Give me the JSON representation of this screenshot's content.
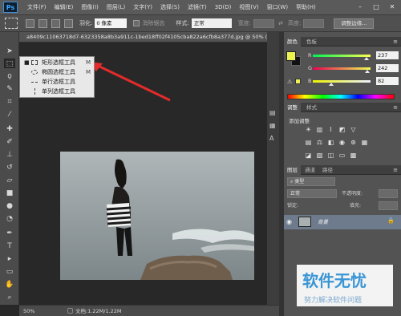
{
  "app": {
    "logo": "Ps",
    "menus": [
      "文件(F)",
      "编辑(E)",
      "图像(I)",
      "图层(L)",
      "文字(Y)",
      "选择(S)",
      "滤镜(T)",
      "3D(D)",
      "视图(V)",
      "窗口(W)",
      "帮助(H)"
    ],
    "window_buttons": [
      "–",
      "□",
      "✕"
    ]
  },
  "options_bar": {
    "feather_label": "羽化:",
    "feather_value": "0 像素",
    "antialias_label": "消除锯齿",
    "style_label": "样式:",
    "style_value": "正常",
    "width_label": "宽度:",
    "height_label": "高度:",
    "refine_button": "调整边缘..."
  },
  "document": {
    "tab_title": "a8409c11063718d7-6323358a8b3a911c-1bed18ff02f4105cba822a6cfb8a377d.jpg @ 50% (RGB/8)"
  },
  "flyout": {
    "items": [
      {
        "label": "矩形选框工具",
        "key": "M",
        "selected": true
      },
      {
        "label": "椭圆选框工具",
        "key": "M",
        "selected": false
      },
      {
        "label": "单行选框工具",
        "key": "",
        "selected": false
      },
      {
        "label": "单列选框工具",
        "key": "",
        "selected": false
      }
    ]
  },
  "status": {
    "zoom": "50%",
    "doc_info": "文档:1.22M/1.22M"
  },
  "color_panel": {
    "tabs": [
      "颜色",
      "色板"
    ],
    "fg_color": "#edf252",
    "channels": [
      {
        "label": "R",
        "value": "237",
        "fraction": 0.929
      },
      {
        "label": "G",
        "value": "242",
        "fraction": 0.949
      },
      {
        "label": "B",
        "value": "82",
        "fraction": 0.322
      }
    ]
  },
  "adjust_panel": {
    "tabs": [
      "调整",
      "样式"
    ],
    "title": "添加调整"
  },
  "layers_panel": {
    "tabs": [
      "图层",
      "通道",
      "路径"
    ],
    "kind_label": "类型",
    "blend_mode": "正常",
    "opacity_label": "不透明度:",
    "lock_label": "锁定:",
    "fill_label": "填充:",
    "layer_name": "背景"
  },
  "watermark": {
    "title": "软件无忧",
    "subtitle": "努力解决软件问题"
  }
}
